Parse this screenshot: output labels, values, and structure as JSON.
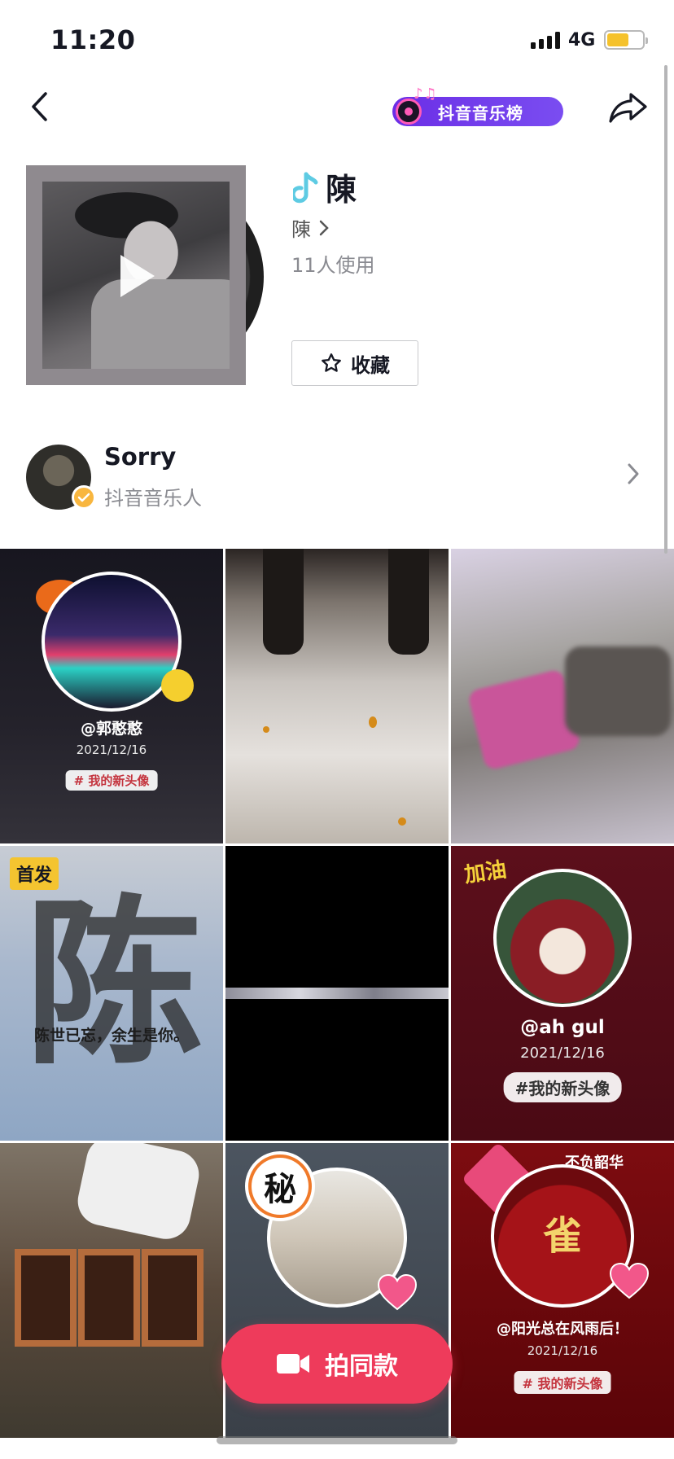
{
  "status_bar": {
    "time": "11:20",
    "network": "4G"
  },
  "header": {
    "music_chart_label": "抖音音乐榜"
  },
  "song": {
    "title": "陳",
    "artist": "陳",
    "usage_count": "11人使用",
    "favorite_label": "收藏"
  },
  "creator": {
    "name": "Sorry",
    "role": "抖音音乐人"
  },
  "videos": [
    {
      "handle": "@郭憨憨",
      "date": "2021/12/16",
      "tag": "# 我的新头像"
    },
    {},
    {},
    {
      "badge": "首发",
      "big_char": "陈",
      "caption": "陈世已忘，余生是你。"
    },
    {},
    {
      "sticker": "加油",
      "handle": "@ah gul",
      "date": "2021/12/16",
      "tag": "#我的新头像"
    },
    {},
    {
      "secret_badge": "秘"
    },
    {
      "sticker": "不负韶华",
      "big_char": "雀",
      "handle": "@阳光总在风雨后！",
      "date": "2021/12/16",
      "tag": "# 我的新头像"
    }
  ],
  "actions": {
    "shoot_same_label": "拍同款"
  },
  "colors": {
    "accent": "#ee3b5b",
    "chart_purple": "#7a4df1",
    "verified": "#f8b63f"
  },
  "icons": [
    "back-arrow-icon",
    "share-icon",
    "music-note-icon",
    "chevron-right-icon",
    "star-icon",
    "play-icon",
    "video-camera-icon",
    "verified-badge-icon"
  ]
}
